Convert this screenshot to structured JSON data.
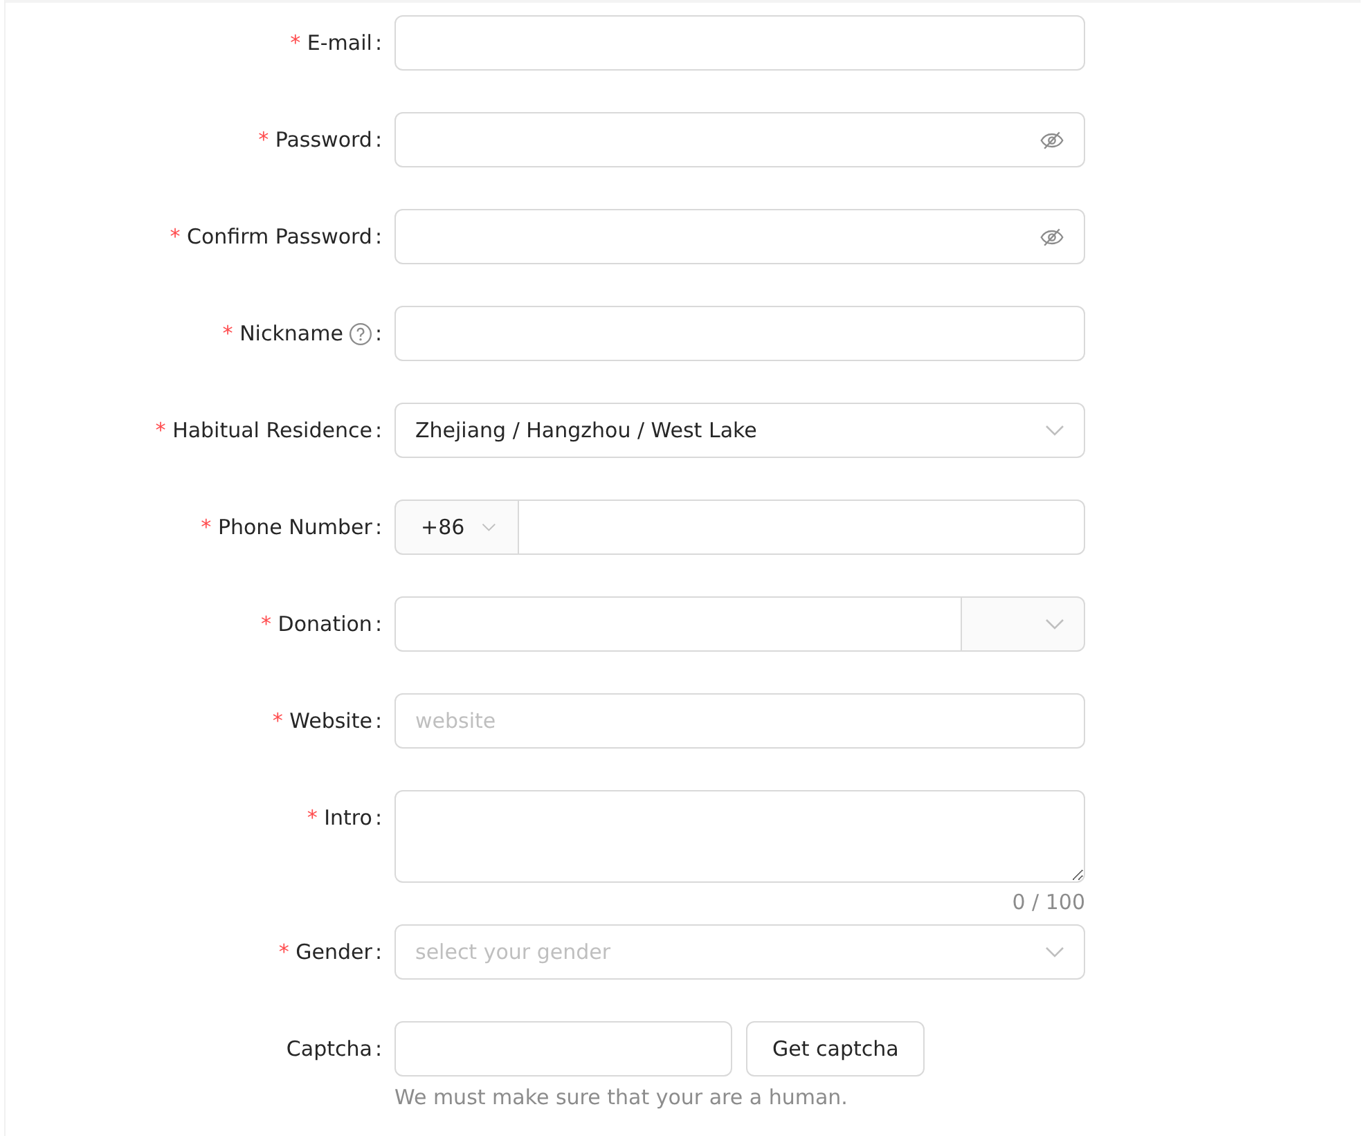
{
  "fields": [
    {
      "label": "E-mail",
      "mark": "*",
      "colon": ":",
      "kind": "input"
    },
    {
      "label": "Password",
      "mark": "*",
      "colon": ":",
      "kind": "password"
    },
    {
      "label": "Confirm Password",
      "mark": "*",
      "colon": ":",
      "kind": "password"
    },
    {
      "label": "Nickname",
      "mark": "*",
      "colon": ":",
      "kind": "input",
      "tooltip": true
    },
    {
      "label": "Habitual Residence",
      "mark": "*",
      "colon": ":",
      "kind": "select",
      "value": "Zhejiang / Hangzhou / West Lake"
    },
    {
      "label": "Phone Number",
      "mark": "*",
      "colon": ":",
      "kind": "phone",
      "prefix": "+86"
    },
    {
      "label": "Donation",
      "mark": "*",
      "colon": ":",
      "kind": "addon-select"
    },
    {
      "label": "Website",
      "mark": "*",
      "colon": ":",
      "kind": "input",
      "placeholder": "website"
    },
    {
      "label": "Intro",
      "mark": "*",
      "colon": ":",
      "kind": "textarea",
      "count": "0 / 100"
    },
    {
      "label": "Gender",
      "mark": "*",
      "colon": ":",
      "kind": "select",
      "placeholder": "select your gender"
    },
    {
      "label": "Captcha",
      "colon": ":",
      "kind": "captcha",
      "button": "Get captcha",
      "extra": "We must make sure that your are a human."
    }
  ]
}
